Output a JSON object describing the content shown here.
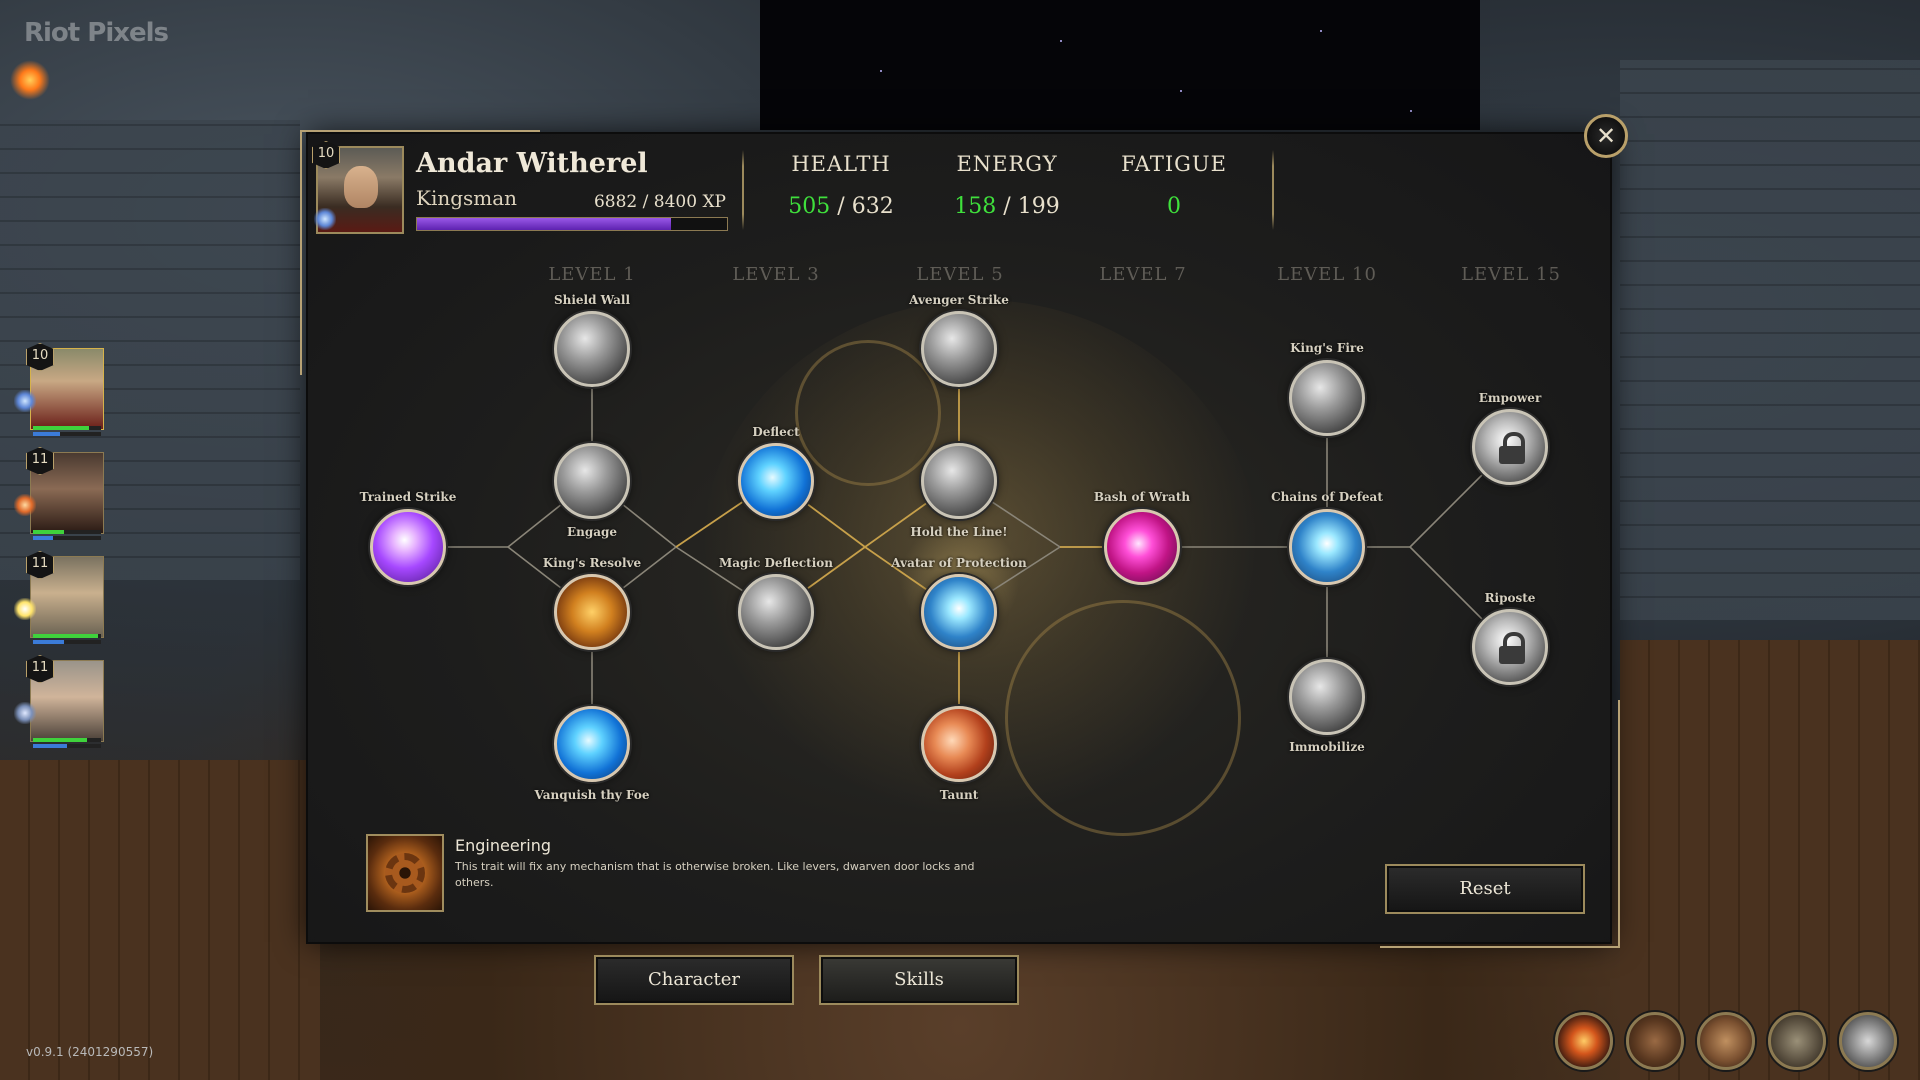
{
  "watermark": "Riot Pixels",
  "version": "v0.9.1 (2401290557)",
  "character": {
    "level": "10",
    "name": "Andar Witherel",
    "class": "Kingsman",
    "xp_text": "6882 / 8400 XP",
    "xp_progress": 0.82
  },
  "stats": {
    "health": {
      "label": "HEALTH",
      "current": "505",
      "sep": " / ",
      "max": "632"
    },
    "energy": {
      "label": "ENERGY",
      "current": "158",
      "sep": " / ",
      "max": "199"
    },
    "fatigue": {
      "label": "FATIGUE",
      "current": "0"
    }
  },
  "levels": [
    "LEVEL 1",
    "LEVEL 3",
    "LEVEL 5",
    "LEVEL 7",
    "LEVEL 10",
    "LEVEL 15"
  ],
  "skills": {
    "trained_strike": {
      "label": "Trained Strike",
      "icon": "sword-slash-icon",
      "color": "#a648ff"
    },
    "shield_wall": {
      "label": "Shield Wall",
      "icon": "shield-icon",
      "color": "#9a9a9a"
    },
    "engage": {
      "label": "Engage",
      "icon": "charge-icon",
      "color": "#9a9a9a"
    },
    "kings_resolve": {
      "label": "King's Resolve",
      "icon": "banner-shield-icon",
      "color": "#d1801f"
    },
    "vanquish_thy_foe": {
      "label": "Vanquish thy Foe",
      "icon": "gauntlet-icon",
      "color": "#1172d6"
    },
    "deflect": {
      "label": "Deflect",
      "icon": "spark-shield-icon",
      "color": "#1172d6"
    },
    "magic_deflection": {
      "label": "Magic Deflection",
      "icon": "warding-icon",
      "color": "#9a9a9a"
    },
    "avenger_strike": {
      "label": "Avenger Strike",
      "icon": "strike-icon",
      "color": "#9a9a9a"
    },
    "hold_the_line": {
      "label": "Hold the Line!",
      "icon": "phalanx-icon",
      "color": "#9a9a9a"
    },
    "avatar_of_protection": {
      "label": "Avatar of Protection",
      "icon": "avatar-icon",
      "color": "#2f83c9"
    },
    "taunt": {
      "label": "Taunt",
      "icon": "shout-face-icon",
      "color": "#e88a55"
    },
    "bash_of_wrath": {
      "label": "Bash of Wrath",
      "icon": "wrath-icon",
      "color": "#c01485"
    },
    "kings_fire": {
      "label": "King's Fire",
      "icon": "flame-sword-icon",
      "color": "#9a9a9a"
    },
    "chains_of_defeat": {
      "label": "Chains of Defeat",
      "icon": "chains-icon",
      "color": "#2f83c9"
    },
    "immobilize": {
      "label": "Immobilize",
      "icon": "hammer-icon",
      "color": "#9a9a9a"
    },
    "empower": {
      "label": "Empower",
      "icon": "lock-icon",
      "color": "#b9b9b9"
    },
    "riposte": {
      "label": "Riposte",
      "icon": "lock-icon",
      "color": "#b9b9b9"
    }
  },
  "selected_trait": {
    "title": "Engineering",
    "description": "This trait will fix any mechanism that is otherwise broken. Like levers, dwarven door locks and others.",
    "icon": "gear-icon"
  },
  "buttons": {
    "reset": "Reset",
    "character": "Character",
    "skills": "Skills",
    "close": "✕"
  },
  "party": [
    {
      "level": "10",
      "health": 0.82,
      "energy": 0.4
    },
    {
      "level": "11",
      "health": 0.45,
      "energy": 0.3
    },
    {
      "level": "11",
      "health": 0.95,
      "energy": 0.45
    },
    {
      "level": "11",
      "health": 0.8,
      "energy": 0.5
    }
  ],
  "toolbar": [
    "campfire-icon",
    "backpack-icon",
    "journal-icon",
    "map-icon",
    "settings-gear-icon"
  ]
}
